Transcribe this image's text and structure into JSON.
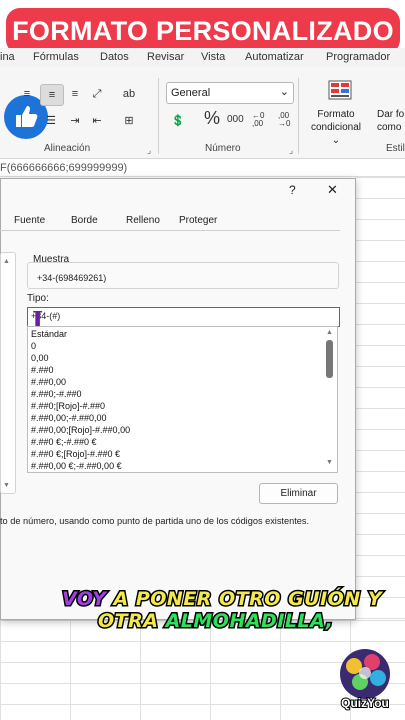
{
  "banner": {
    "title": "FORMATO PERSONALIZADO"
  },
  "ribbon": {
    "menu": [
      "ina",
      "Fórmulas",
      "Datos",
      "Revisar",
      "Vista",
      "Automatizar",
      "Programador"
    ],
    "alignment_label": "Alineación",
    "number_label": "Número",
    "styles_label": "Estile",
    "number_format": "General",
    "percent_symbol": "%",
    "thousands_symbol": "000",
    "dec_increase": "←0 ,00",
    "dec_decrease": ",00 →0",
    "conditional_format_line1": "Formato",
    "conditional_format_line2": "condicional",
    "format_table_line1": "Dar fo",
    "format_table_line2": "como"
  },
  "formula_bar": {
    "text": "F(666666666;699999999)"
  },
  "dialog": {
    "tabs": [
      "Fuente",
      "Borde",
      "Relleno",
      "Proteger"
    ],
    "help": "?",
    "close": "✕",
    "sample_label": "Muestra",
    "sample_value": "+34-(698469261)",
    "type_label": "Tipo:",
    "type_value": "+34-(#)",
    "list_items": [
      "Estándar",
      "0",
      "0,00",
      "#.##0",
      "#.##0,00",
      "#.##0;-#.##0",
      "#.##0;[Rojo]-#.##0",
      "#.##0,00;-#.##0,00",
      "#.##0,00;[Rojo]-#.##0,00",
      "#.##0 €;-#.##0 €",
      "#.##0 €;[Rojo]-#.##0 €",
      "#.##0,00 €;-#.##0,00 €"
    ],
    "delete_button": "Eliminar",
    "description": "to de número, usando como punto de partida uno de los códigos existentes."
  },
  "subtitle": {
    "line1_word1": "VOY",
    "line1_rest": "A PONER OTRO GUIÓN Y",
    "line2_word1": "OTRA",
    "line2_word2": "ALMOHADILLA,"
  },
  "logo": {
    "text": "QuizYou"
  },
  "colors": {
    "banner": "#ee3b4c",
    "subtitle_yellow": "#f3e94a",
    "subtitle_green": "#2fe05a",
    "subtitle_purple": "#a040e0"
  }
}
